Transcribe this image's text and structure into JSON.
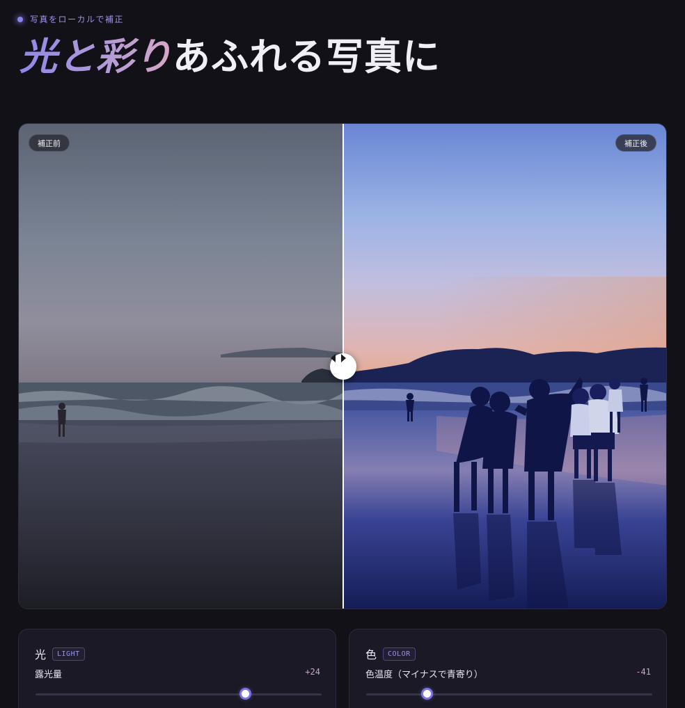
{
  "header": {
    "eyebrow": "写真をローカルで補正",
    "headline_accent": "光と彩り",
    "headline_rest": "あふれる写真に"
  },
  "compare": {
    "before_label": "補正前",
    "after_label": "補正後",
    "split_position_percent": 50
  },
  "panels": {
    "light": {
      "title": "光",
      "tag": "LIGHT",
      "param_name": "露光量",
      "value_text": "+24",
      "level_fraction": 0.73
    },
    "color": {
      "title": "色",
      "tag": "COLOR",
      "param_name": "色温度（マイナスで青寄り）",
      "value_text": "-41",
      "level_fraction": 0.21
    }
  },
  "colors": {
    "accent": "#8a84f0",
    "value_pink": "#d0a3c8"
  },
  "icons": {
    "split_handle": "left-right-arrows-icon",
    "eyebrow_dot": "dot-icon"
  }
}
